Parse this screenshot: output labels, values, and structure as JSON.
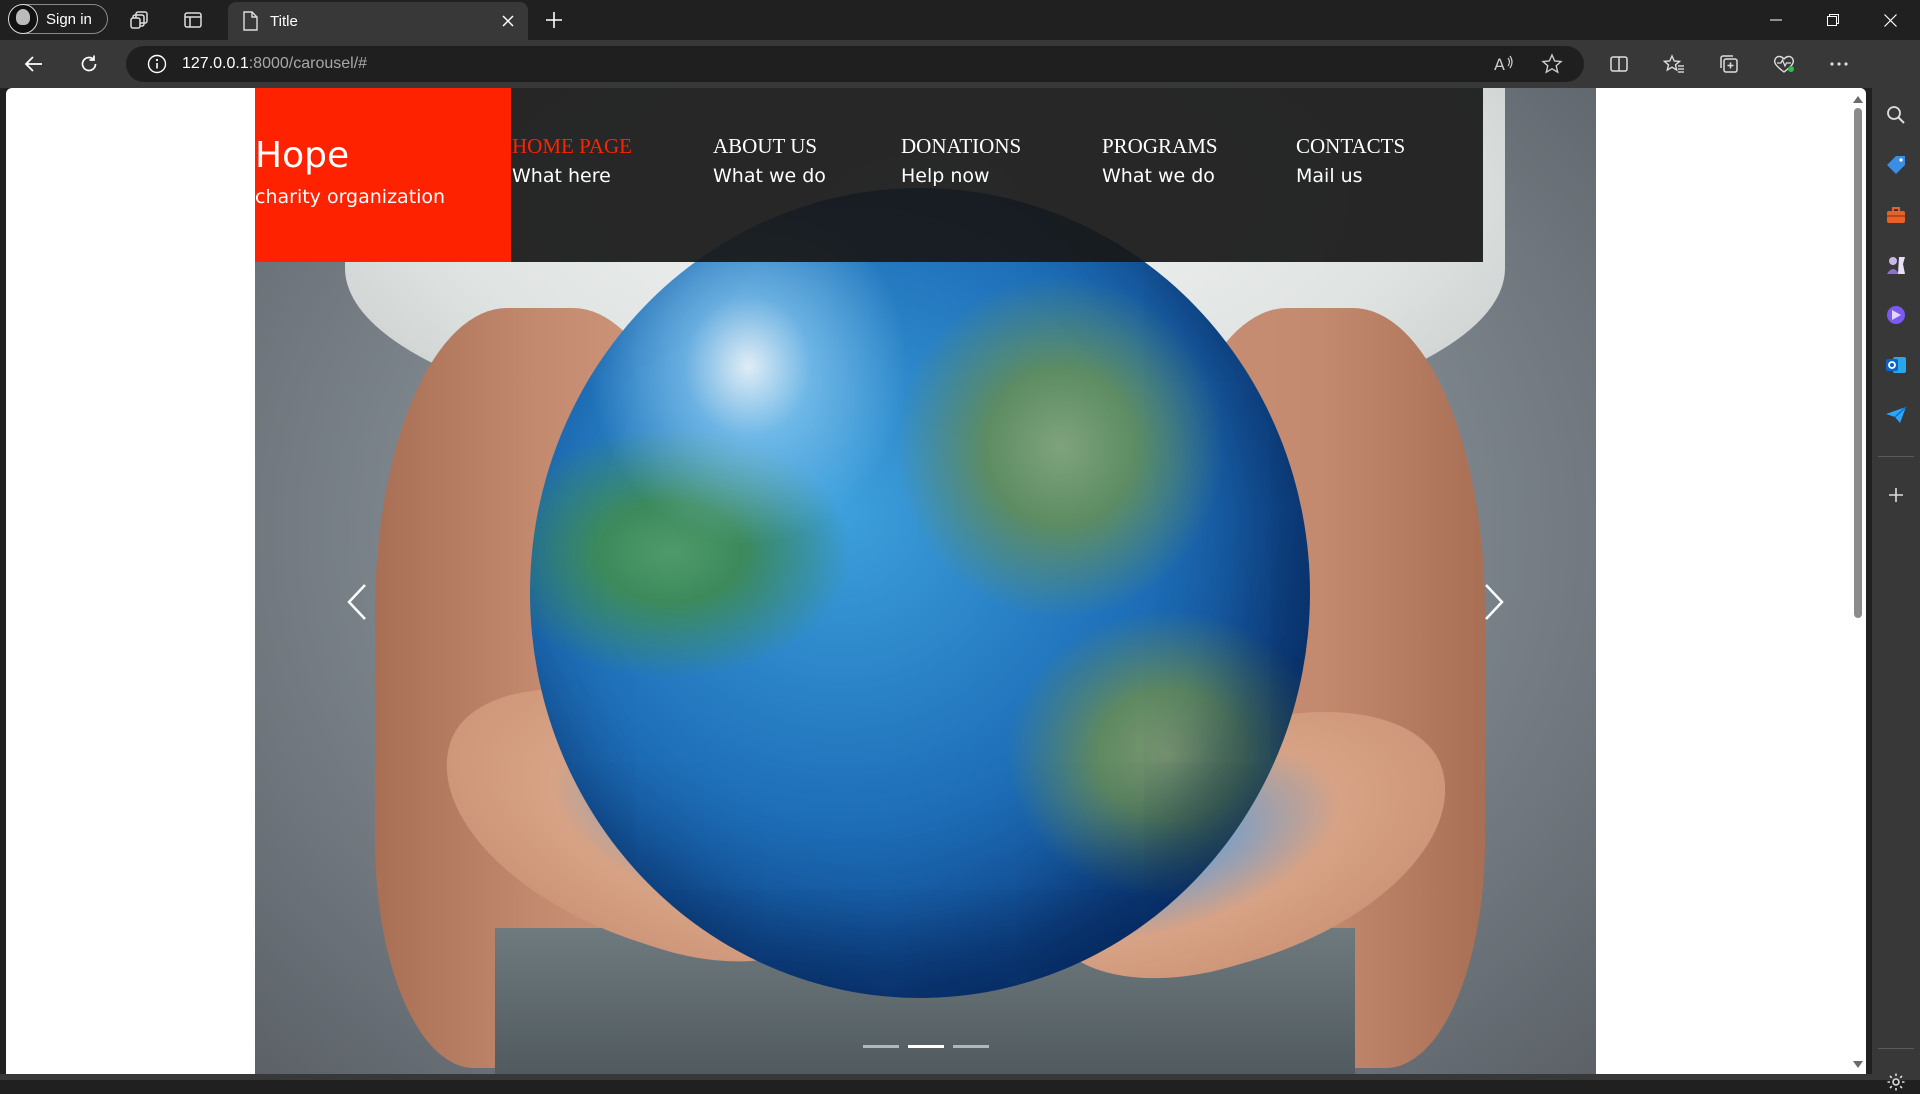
{
  "browser": {
    "profile_label": "Sign in",
    "tab_title": "Title",
    "url_host": "127.0.0.1",
    "url_path": ":8000/carousel/#"
  },
  "site": {
    "brand_name": "Hope",
    "brand_tagline": "charity organization",
    "accent_color": "#ff2200",
    "nav": [
      {
        "title": "HOME PAGE",
        "subtitle": "What here"
      },
      {
        "title": "ABOUT US",
        "subtitle": "What we do"
      },
      {
        "title": "DONATIONS",
        "subtitle": "Help now"
      },
      {
        "title": "PROGRAMS",
        "subtitle": "What we do"
      },
      {
        "title": "CONTACTS",
        "subtitle": "Mail us"
      }
    ],
    "carousel": {
      "slide_count": 3,
      "active_slide": 2
    }
  }
}
